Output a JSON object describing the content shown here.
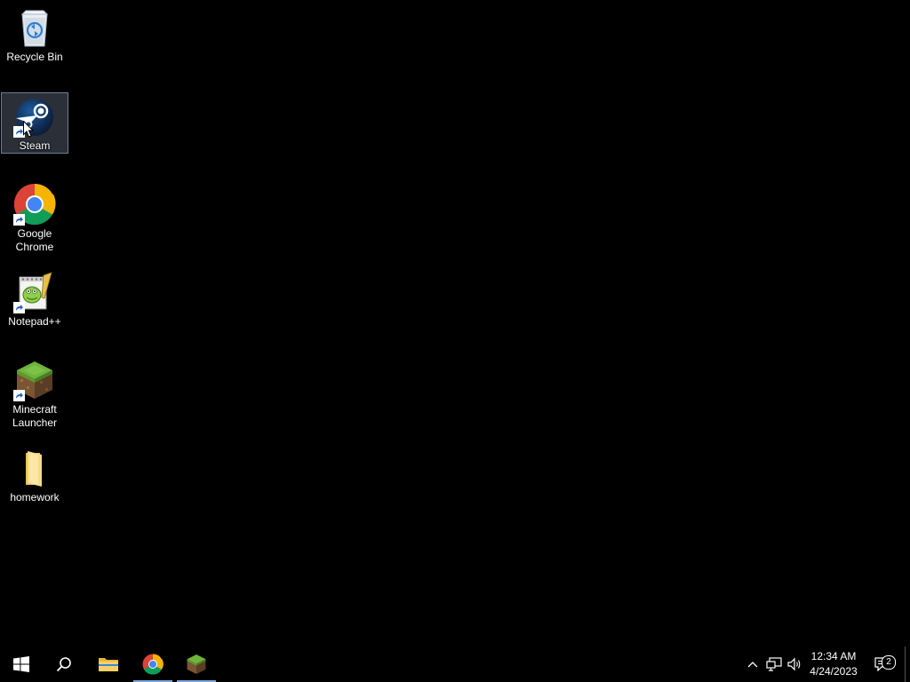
{
  "desktop": {
    "icons": [
      {
        "label": "Recycle Bin",
        "icon": "recycle-bin-icon",
        "shortcut": false,
        "selected": false
      },
      {
        "label": "Steam",
        "icon": "steam-icon",
        "shortcut": true,
        "selected": true
      },
      {
        "label": "Google Chrome",
        "icon": "chrome-icon",
        "shortcut": true,
        "selected": false
      },
      {
        "label": "Notepad++",
        "icon": "notepad-plus-plus-icon",
        "shortcut": true,
        "selected": false
      },
      {
        "label": "Minecraft Launcher",
        "icon": "minecraft-launcher-icon",
        "shortcut": true,
        "selected": false
      },
      {
        "label": "homework",
        "icon": "folder-icon",
        "shortcut": false,
        "selected": false
      }
    ]
  },
  "taskbar": {
    "items": [
      {
        "name": "start",
        "icon": "windows-start-icon"
      },
      {
        "name": "search",
        "icon": "search-icon"
      },
      {
        "name": "file-explorer",
        "icon": "folder-icon"
      },
      {
        "name": "chrome",
        "icon": "chrome-icon",
        "running": true
      },
      {
        "name": "minecraft-launcher",
        "icon": "minecraft-launcher-icon",
        "running": true
      }
    ],
    "tray": {
      "time": "12:34 AM",
      "date": "4/24/2023",
      "notification_count": "2"
    }
  },
  "colors": {
    "background": "#000000",
    "taskbar": "#000000",
    "active_indicator": "#7aa7d9",
    "selection": "#96aac8"
  }
}
